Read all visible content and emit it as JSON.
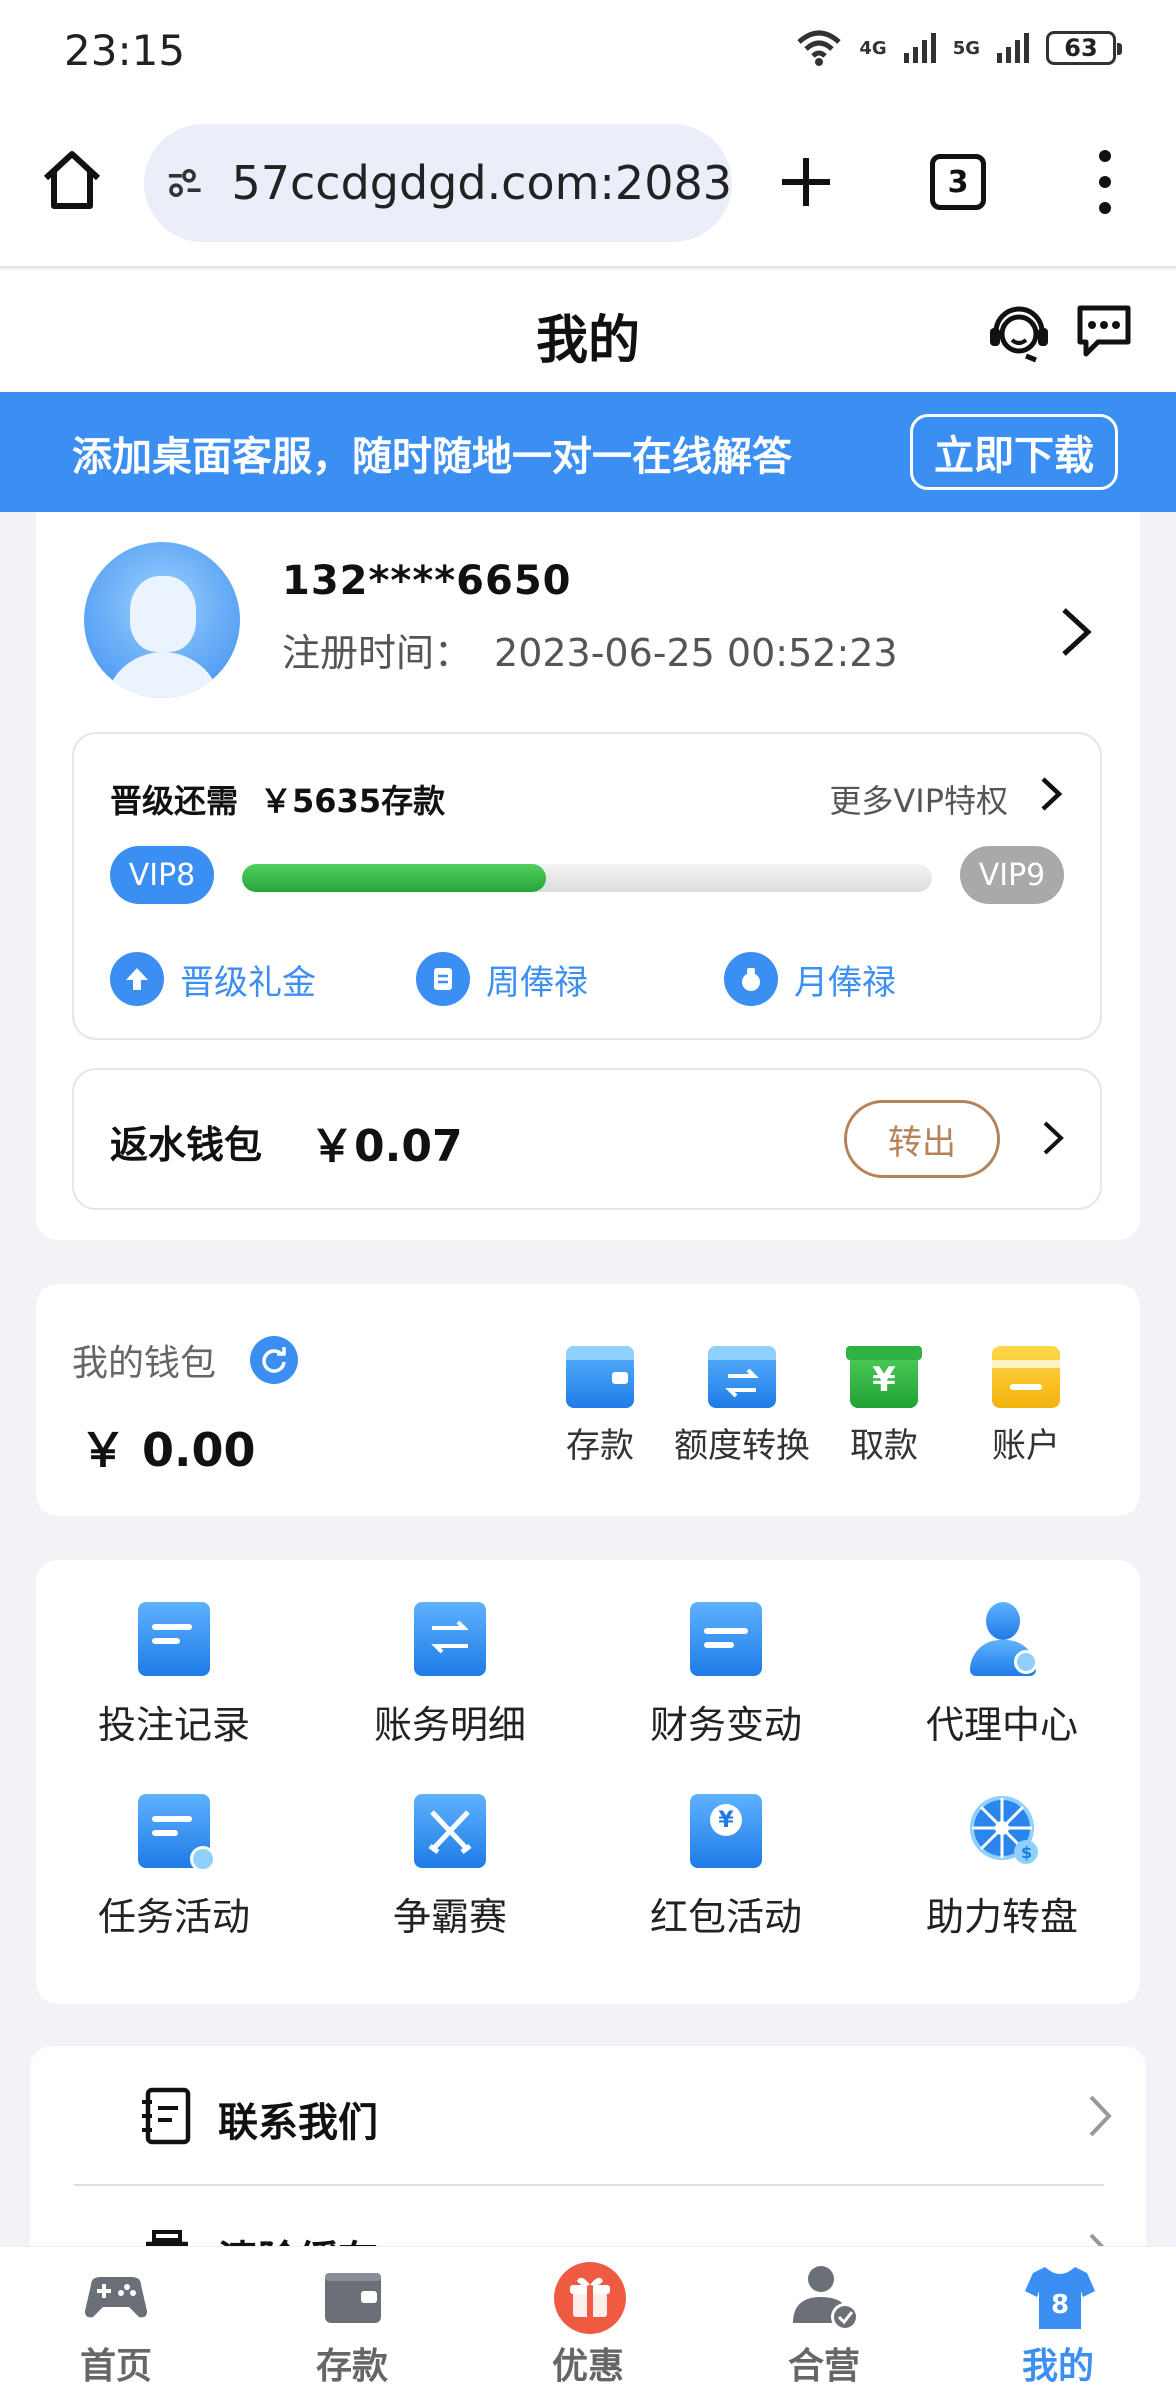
{
  "status_bar": {
    "time": "23:15",
    "network_1": "4G",
    "network_2": "5G",
    "battery": "63"
  },
  "browser": {
    "url": "57ccdgdgd.com:2083",
    "tab_count": "3"
  },
  "header": {
    "title": "我的"
  },
  "banner": {
    "text": "添加桌面客服，随时随地一对一在线解答",
    "download_label": "立即下载"
  },
  "profile": {
    "phone": "132****6650",
    "register_label": "注册时间：",
    "register_time": "2023-06-25 00:52:23"
  },
  "vip": {
    "need_label": "晋级还需",
    "need_amount": "￥5635存款",
    "more_label": "更多VIP特权",
    "current_level": "VIP8",
    "next_level": "VIP9",
    "progress": 0.44,
    "perks": [
      "晋级礼金",
      "周俸禄",
      "月俸禄"
    ]
  },
  "rebate": {
    "label": "返水钱包",
    "amount": "￥0.07",
    "transfer_label": "转出"
  },
  "wallet": {
    "label": "我的钱包",
    "balance": "￥ 0.00",
    "actions": [
      "存款",
      "额度转换",
      "取款",
      "账户"
    ]
  },
  "menu_grid": {
    "items": [
      "投注记录",
      "账务明细",
      "财务变动",
      "代理中心",
      "任务活动",
      "争霸赛",
      "红包活动",
      "助力转盘"
    ]
  },
  "list": {
    "items": [
      "联系我们",
      "清除缓存"
    ]
  },
  "bottom_nav": {
    "items": [
      "首页",
      "存款",
      "优惠",
      "合营",
      "我的"
    ],
    "active": "我的"
  },
  "colors": {
    "accent": "#3b8ff3",
    "progress": "#2fb144",
    "transfer": "#b5835a"
  }
}
